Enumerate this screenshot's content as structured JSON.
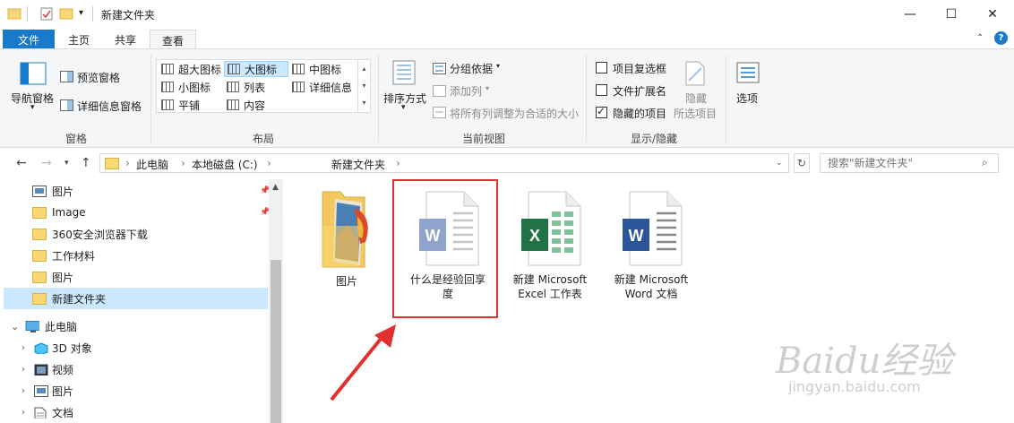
{
  "window": {
    "title": "新建文件夹"
  },
  "tabs": {
    "file": "文件",
    "home": "主页",
    "share": "共享",
    "view": "查看"
  },
  "ribbon": {
    "panes": {
      "nav_pane": "导航窗格",
      "preview_pane": "预览窗格",
      "details_pane": "详细信息窗格",
      "group_label": "窗格"
    },
    "layout": {
      "items": [
        "超大图标",
        "大图标",
        "中图标",
        "小图标",
        "列表",
        "详细信息",
        "平铺",
        "内容"
      ],
      "selected": "大图标",
      "group_label": "布局"
    },
    "current_view": {
      "sort_by": "排序方式",
      "group_by": "分组依据",
      "add_columns": "添加列",
      "size_columns": "将所有列调整为合适的大小",
      "group_label": "当前视图"
    },
    "show_hide": {
      "item_checkboxes": "项目复选框",
      "item_checkboxes_checked": false,
      "file_extensions": "文件扩展名",
      "file_extensions_checked": false,
      "hidden_items": "隐藏的项目",
      "hidden_items_checked": true,
      "hide_selected_1": "隐藏",
      "hide_selected_2": "所选项目",
      "group_label": "显示/隐藏"
    },
    "options": "选项"
  },
  "address": {
    "crumbs": [
      "此电脑",
      "本地磁盘 (C:)",
      "新建文件夹"
    ],
    "search_placeholder": "搜索\"新建文件夹\""
  },
  "nav_items": [
    {
      "label": "图片",
      "icon": "pictures-icon",
      "pinned": true
    },
    {
      "label": "Image",
      "icon": "folder-icon",
      "pinned": true
    },
    {
      "label": "360安全浏览器下载",
      "icon": "folder-icon",
      "pinned": false
    },
    {
      "label": "工作材料",
      "icon": "folder-icon",
      "pinned": false
    },
    {
      "label": "图片",
      "icon": "folder-icon",
      "pinned": false
    },
    {
      "label": "新建文件夹",
      "icon": "folder-icon",
      "pinned": false,
      "selected": true
    },
    {
      "label": "此电脑",
      "icon": "computer-icon",
      "expanded": true
    },
    {
      "label": "3D 对象",
      "icon": "3d-objects-icon"
    },
    {
      "label": "视频",
      "icon": "video-icon"
    },
    {
      "label": "图片",
      "icon": "pictures-icon"
    },
    {
      "label": "文档",
      "icon": "documents-icon"
    }
  ],
  "files": [
    {
      "name": "图片",
      "type": "folder"
    },
    {
      "name": "什么是经验回享度",
      "line1": "什么是经验回享",
      "line2": "度",
      "type": "word-doc"
    },
    {
      "name": "新建 Microsoft Excel 工作表",
      "line1": "新建 Microsoft",
      "line2": "Excel 工作表",
      "type": "excel"
    },
    {
      "name": "新建 Microsoft Word 文档",
      "line1": "新建 Microsoft",
      "line2": "Word 文档",
      "type": "word"
    }
  ],
  "watermark": {
    "brand": "Baidu经验",
    "url": "jingyan.baidu.com"
  },
  "colors": {
    "accent": "#1979ca",
    "selection": "#cce8ff",
    "highlight_box": "#e03030",
    "word": "#2b579a",
    "excel": "#217346"
  }
}
